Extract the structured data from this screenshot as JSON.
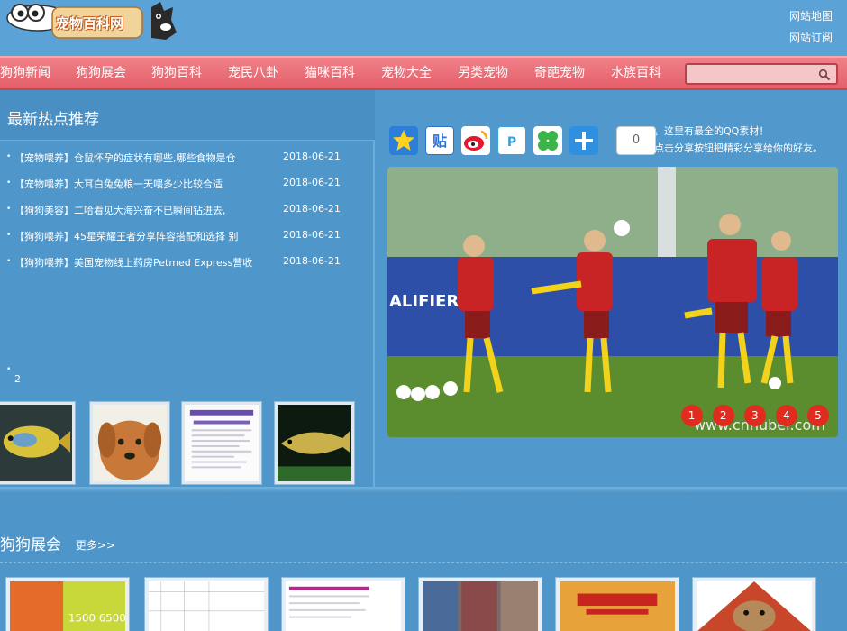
{
  "site": {
    "logo_text": "宠物百科网"
  },
  "top_links": [
    "网站地图",
    "网站订阅"
  ],
  "nav": {
    "items": [
      "狗狗新闻",
      "狗狗展会",
      "狗狗百科",
      "宠民八卦",
      "猫咪百科",
      "宠物大全",
      "另类宠物",
      "奇葩宠物",
      "水族百科"
    ],
    "search_placeholder": ""
  },
  "hot": {
    "title": "最新热点推荐",
    "news": [
      {
        "title": "【宠物喂养】仓鼠怀孕的症状有哪些,哪些食物是仓",
        "date": "2018-06-21"
      },
      {
        "title": "【宠物喂养】大耳白兔兔粮一天喂多少比较合适",
        "date": "2018-06-21"
      },
      {
        "title": "【狗狗美容】二哈看见大海兴奋不已瞬间钻进去,",
        "date": "2018-06-21"
      },
      {
        "title": "【狗狗喂养】45星荣耀王者分享阵容搭配和选择 别",
        "date": "2018-06-21"
      },
      {
        "title": "【狗狗喂养】美国宠物线上药房Petmed Express营收",
        "date": "2018-06-21"
      }
    ],
    "page_number": "2",
    "thumbnails": [
      "fish-yellow",
      "golden-dog",
      "document",
      "arowana-fish"
    ]
  },
  "share": {
    "icons": [
      "qzone-icon",
      "tieba-icon",
      "weibo-icon",
      "tencent-weibo-icon",
      "pengyou-icon",
      "more-share-icon"
    ],
    "count": "0",
    "text_line1": "，这里有最全的QQ素材！",
    "text_line2": "点击分享按钮把精彩分享给你的好友。"
  },
  "slider": {
    "dots": [
      "1",
      "2",
      "3",
      "4",
      "5"
    ],
    "watermark": "www.cnhubei.com"
  },
  "section2": {
    "title": "狗狗展会",
    "more": "更多>>",
    "items": [
      "expo-poster-1",
      "expo-document-1",
      "expo-document-2",
      "expo-crowd",
      "expo-banner",
      "expo-dog"
    ]
  },
  "colors": {
    "page_bg": "#5199cd",
    "nav_bg": "#e45f6a",
    "dot_red": "#e12b1f"
  }
}
